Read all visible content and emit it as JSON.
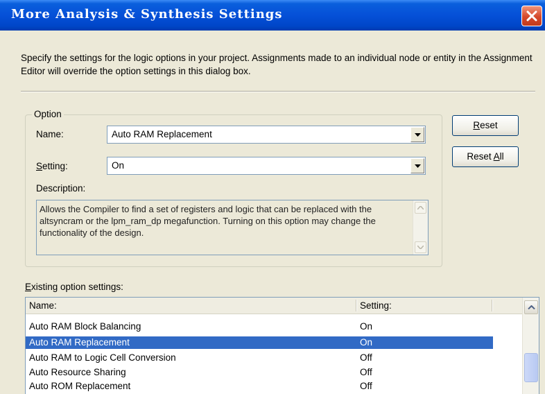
{
  "window": {
    "title": "More Analysis & Synthesis Settings"
  },
  "intro_text": "Specify the settings for the logic options in your project.  Assignments made to an individual node or entity in the Assignment Editor will override the option settings in this dialog box.",
  "option_group": {
    "legend": "Option",
    "name_label": "Name:",
    "name_value": "Auto RAM Replacement",
    "setting_label_first": "S",
    "setting_label_rest": "etting:",
    "setting_value": "On",
    "description_label": "Description:",
    "description_text": "Allows the Compiler to find a set of registers and logic that can be replaced with the altsyncram or the lpm_ram_dp megafunction. Turning on this option may change the functionality of the design."
  },
  "buttons": {
    "reset_first": "R",
    "reset_rest": "eset",
    "reset_all_prefix": "Reset ",
    "reset_all_underlined": "A",
    "reset_all_suffix": "ll"
  },
  "existing": {
    "label_first": "E",
    "label_rest": "xisting option settings:",
    "columns": {
      "name": "Name:",
      "setting": "Setting:"
    },
    "rows": [
      {
        "name": "Auto RAM Block Balancing",
        "setting": "On",
        "selected": false
      },
      {
        "name": "Auto RAM Replacement",
        "setting": "On",
        "selected": true
      },
      {
        "name": "Auto RAM to Logic Cell Conversion",
        "setting": "Off",
        "selected": false
      },
      {
        "name": "Auto Resource Sharing",
        "setting": "Off",
        "selected": false
      },
      {
        "name": "Auto ROM Replacement",
        "setting": "Off",
        "selected": false
      }
    ]
  },
  "colors": {
    "title_bar": "#0550d8",
    "dialog_bg": "#ece9d8",
    "selection": "#316ac5",
    "close_button": "#d5482a"
  },
  "icons": {
    "close": "close-x-icon",
    "dropdown": "chevron-down-icon",
    "scroll_up": "chevron-up-icon",
    "scroll_down": "chevron-down-icon"
  }
}
